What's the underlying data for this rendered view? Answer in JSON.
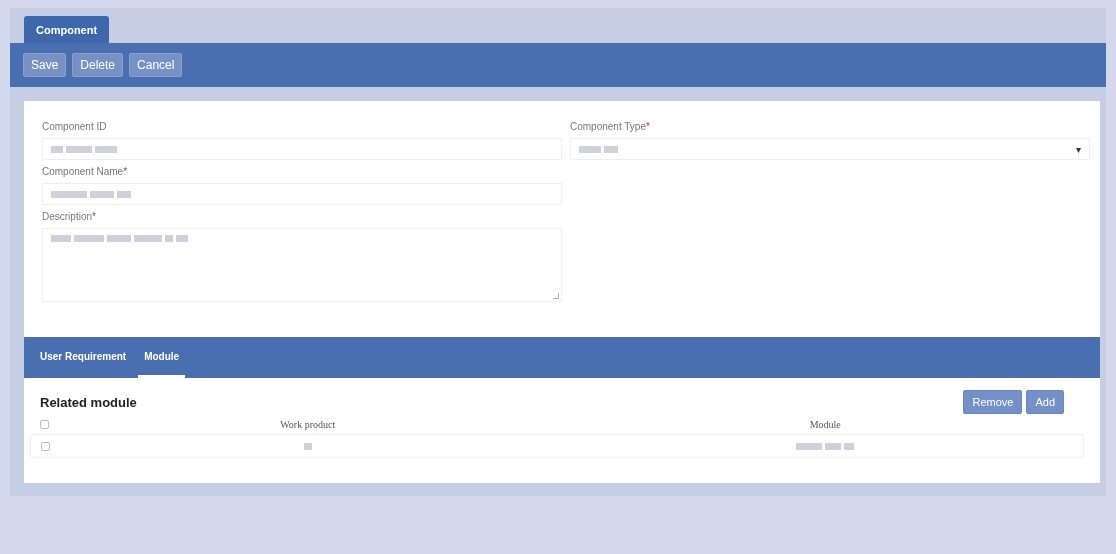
{
  "top_tabs": [
    {
      "label": "Component",
      "selected": true
    }
  ],
  "toolbar": [
    "Save",
    "Delete",
    "Cancel"
  ],
  "form": {
    "left": [
      {
        "label": "Component ID",
        "kind": "input"
      },
      {
        "label": "Component Name",
        "required_mark": "*",
        "kind": "input"
      },
      {
        "label": "Description",
        "required_mark": "*",
        "kind": "textarea"
      }
    ],
    "right": [
      {
        "label": "Component Type",
        "required_mark": "*",
        "kind": "select",
        "caret": "▾"
      }
    ]
  },
  "sub_tabs": [
    {
      "label": "User Requirement",
      "selected": false
    },
    {
      "label": "Module",
      "selected": true
    }
  ],
  "related": {
    "title": "Related module",
    "buttons": [
      "Remove",
      "Add"
    ],
    "columns": [
      "Work product",
      "Module"
    ],
    "rows": [
      {
        "checked": false
      }
    ],
    "header_checked": false
  }
}
